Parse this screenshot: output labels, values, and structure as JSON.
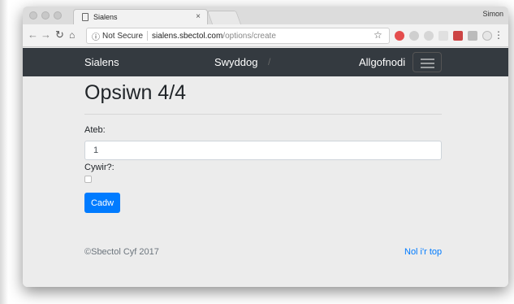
{
  "browser": {
    "tab_title": "Sialens",
    "tab_close": "×",
    "profile_name": "Simon",
    "security_label": "Not Secure",
    "url_host": "sialens.sbectol.com",
    "url_path": "/options/create"
  },
  "navbar": {
    "brand": "Sialens",
    "link": "Swyddog",
    "separator": "/",
    "logout": "Allgofnodi"
  },
  "page": {
    "title": "Opsiwn 4/4",
    "answer_label": "Ateb:",
    "answer_value": "1",
    "correct_label": "Cywir?:",
    "correct_checked": false,
    "save_button": "Cadw"
  },
  "footer": {
    "copyright": "©Sbectol Cyf 2017",
    "back_to_top": "Nol i'r top"
  },
  "colors": {
    "navbar_bg": "#343a40",
    "primary": "#007bff"
  }
}
